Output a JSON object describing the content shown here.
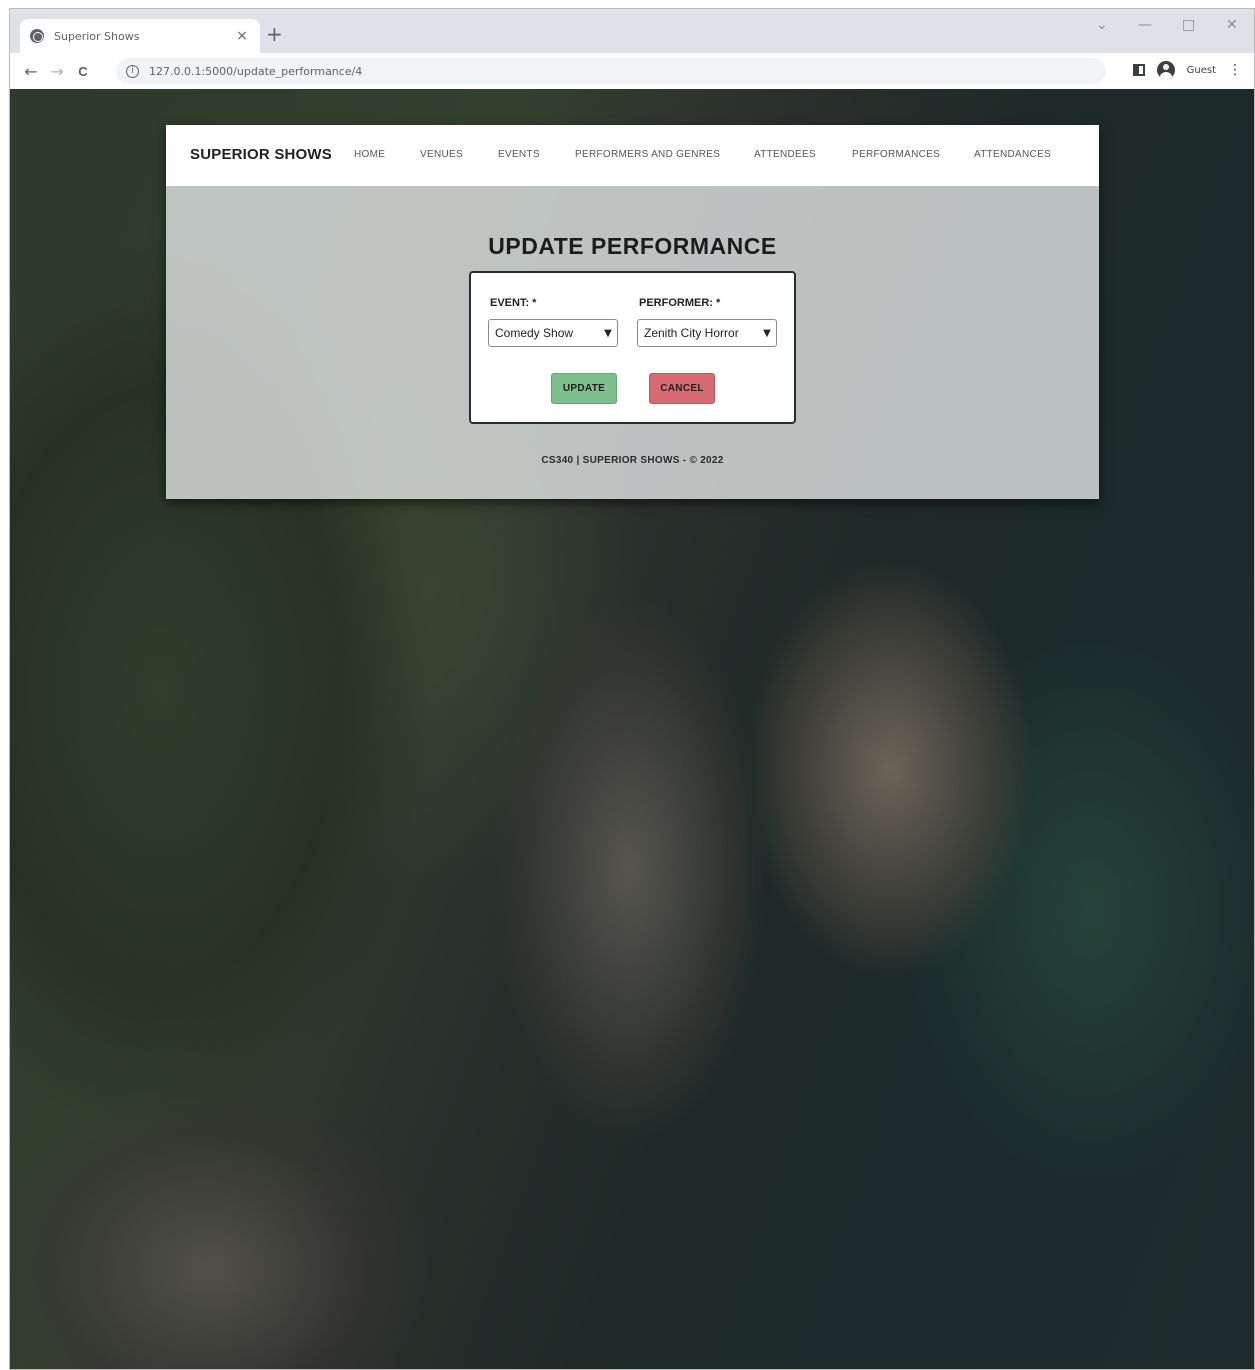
{
  "browser": {
    "tab_title": "Superior Shows",
    "tab_close": "×",
    "new_tab": "+",
    "url": "127.0.0.1:5000/update_performance/4",
    "profile_label": "Guest",
    "back": "←",
    "forward": "→",
    "reload": "C",
    "info": "i",
    "menu": "⋮",
    "minimize": "—",
    "maximize": "□",
    "close": "✕"
  },
  "navbar": {
    "brand": "SUPERIOR SHOWS",
    "links": [
      "HOME",
      "VENUES",
      "EVENTS",
      "PERFORMERS AND GENRES",
      "ATTENDEES",
      "PERFORMANCES",
      "ATTENDANCES"
    ]
  },
  "page": {
    "title": "UPDATE PERFORMANCE"
  },
  "form": {
    "event_label": "EVENT: *",
    "event_value": "Comedy Show",
    "performer_label": "PERFORMER: *",
    "performer_value": "Zenith City Horror",
    "update_label": "UPDATE",
    "cancel_label": "CANCEL",
    "update_color": "#7dbf8d",
    "cancel_color": "#d86a73"
  },
  "footer": {
    "text": "CS340 | SUPERIOR SHOWS - © 2022"
  }
}
